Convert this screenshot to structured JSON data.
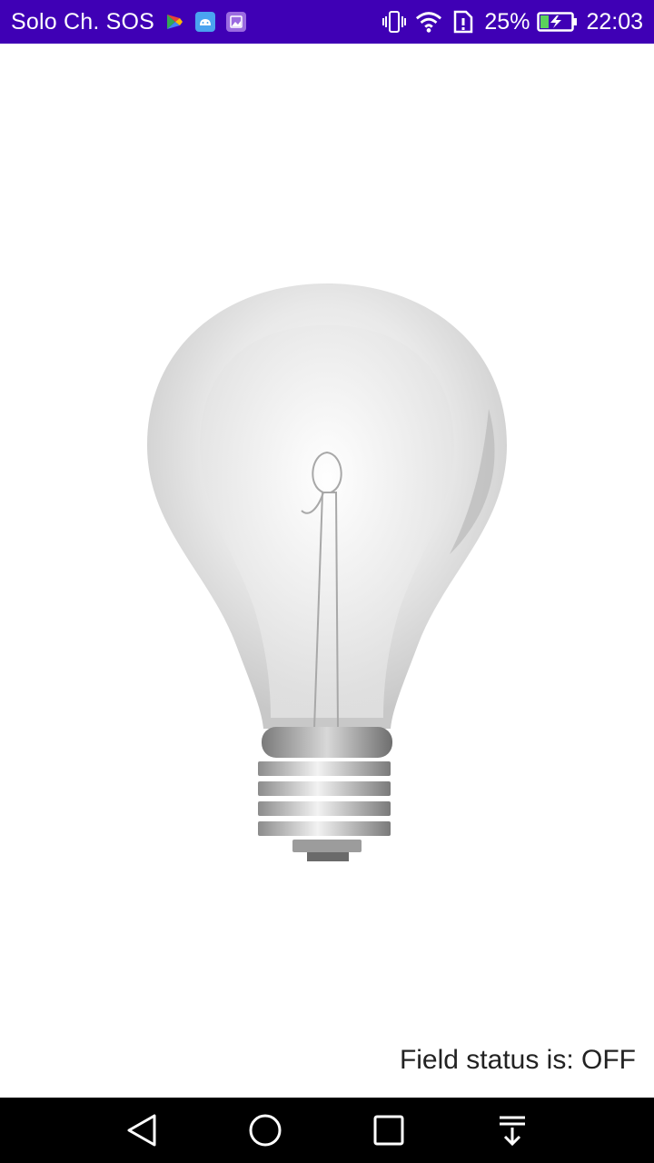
{
  "status_bar": {
    "carrier": "Solo Ch. SOS",
    "battery_percent": "25%",
    "time": "22:03",
    "background_color": "#3f00b5",
    "notification_icons": [
      "play-games-icon",
      "android-icon",
      "gallery-icon"
    ],
    "system_icons": [
      "vibrate-icon",
      "wifi-icon",
      "sim-alert-icon",
      "battery-charging-icon"
    ]
  },
  "main": {
    "bulb_state": "off",
    "field_status": "Field status is: OFF"
  },
  "nav_bar": {
    "buttons": [
      "back-icon",
      "home-icon",
      "recents-icon",
      "notification-pulldown-icon"
    ]
  }
}
